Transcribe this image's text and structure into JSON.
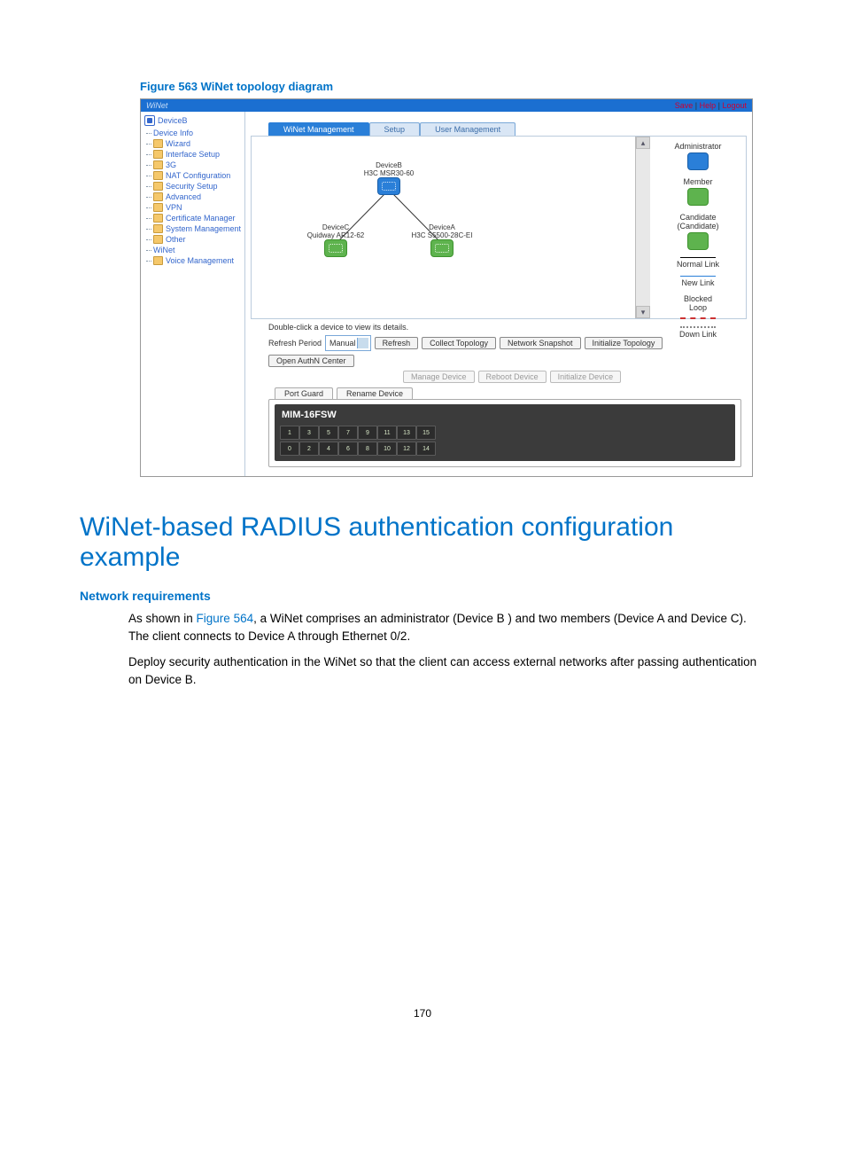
{
  "figure_caption": "Figure 563 WiNet topology diagram",
  "screenshot": {
    "top": {
      "app_name": "WiNet",
      "links": [
        "Save",
        "Help",
        "Logout"
      ]
    },
    "tree": {
      "root": "DeviceB",
      "items": [
        "Device Info",
        "Wizard",
        "Interface Setup",
        "3G",
        "NAT Configuration",
        "Security Setup",
        "Advanced",
        "VPN",
        "Certificate Manager",
        "System Management",
        "Other",
        "WiNet",
        "Voice Management"
      ]
    },
    "tabs": {
      "active": "WiNet Management",
      "others": [
        "Setup",
        "User Management"
      ]
    },
    "topology": {
      "nodes": {
        "b": {
          "label": "DeviceB",
          "model": "H3C MSR30-60"
        },
        "c": {
          "label": "DeviceC",
          "model": "Quidway AR12-62"
        },
        "a": {
          "label": "DeviceA",
          "model": "H3C S5500-28C-EI"
        }
      }
    },
    "legend": {
      "administrator": "Administrator",
      "member": "Member",
      "candidate": "Candidate\n(Candidate)",
      "normal": "Normal Link",
      "newlink": "New Link",
      "blocked": "Blocked\nLoop",
      "down": "Down Link"
    },
    "hint": "Double-click a device to view its details.",
    "controls": {
      "refresh_label": "Refresh Period",
      "refresh_select": "Manual",
      "buttons_row1": [
        "Refresh",
        "Collect Topology",
        "Network Snapshot",
        "Initialize Topology",
        "Open AuthN Center"
      ],
      "buttons_row2": [
        "Manage Device",
        "Reboot Device",
        "Initialize Device"
      ]
    },
    "panel": {
      "tabs": [
        "Port Guard",
        "Rename Device"
      ],
      "switch_title": "MIM-16FSW",
      "ports_top": [
        "1",
        "3",
        "5",
        "7",
        "9",
        "11",
        "13",
        "15"
      ],
      "ports_bottom": [
        "0",
        "2",
        "4",
        "6",
        "8",
        "10",
        "12",
        "14"
      ]
    }
  },
  "section": {
    "title": "WiNet-based RADIUS authentication configuration example",
    "req_heading": "Network requirements",
    "para1_a": "As shown in ",
    "para1_link": "Figure 564",
    "para1_b": ", a WiNet comprises an administrator (Device B ) and two members (Device A and Device C). The client connects to Device A through Ethernet 0/2.",
    "para2": "Deploy security authentication in the WiNet so that the client can access external networks after passing authentication on Device B."
  },
  "page_number": "170"
}
